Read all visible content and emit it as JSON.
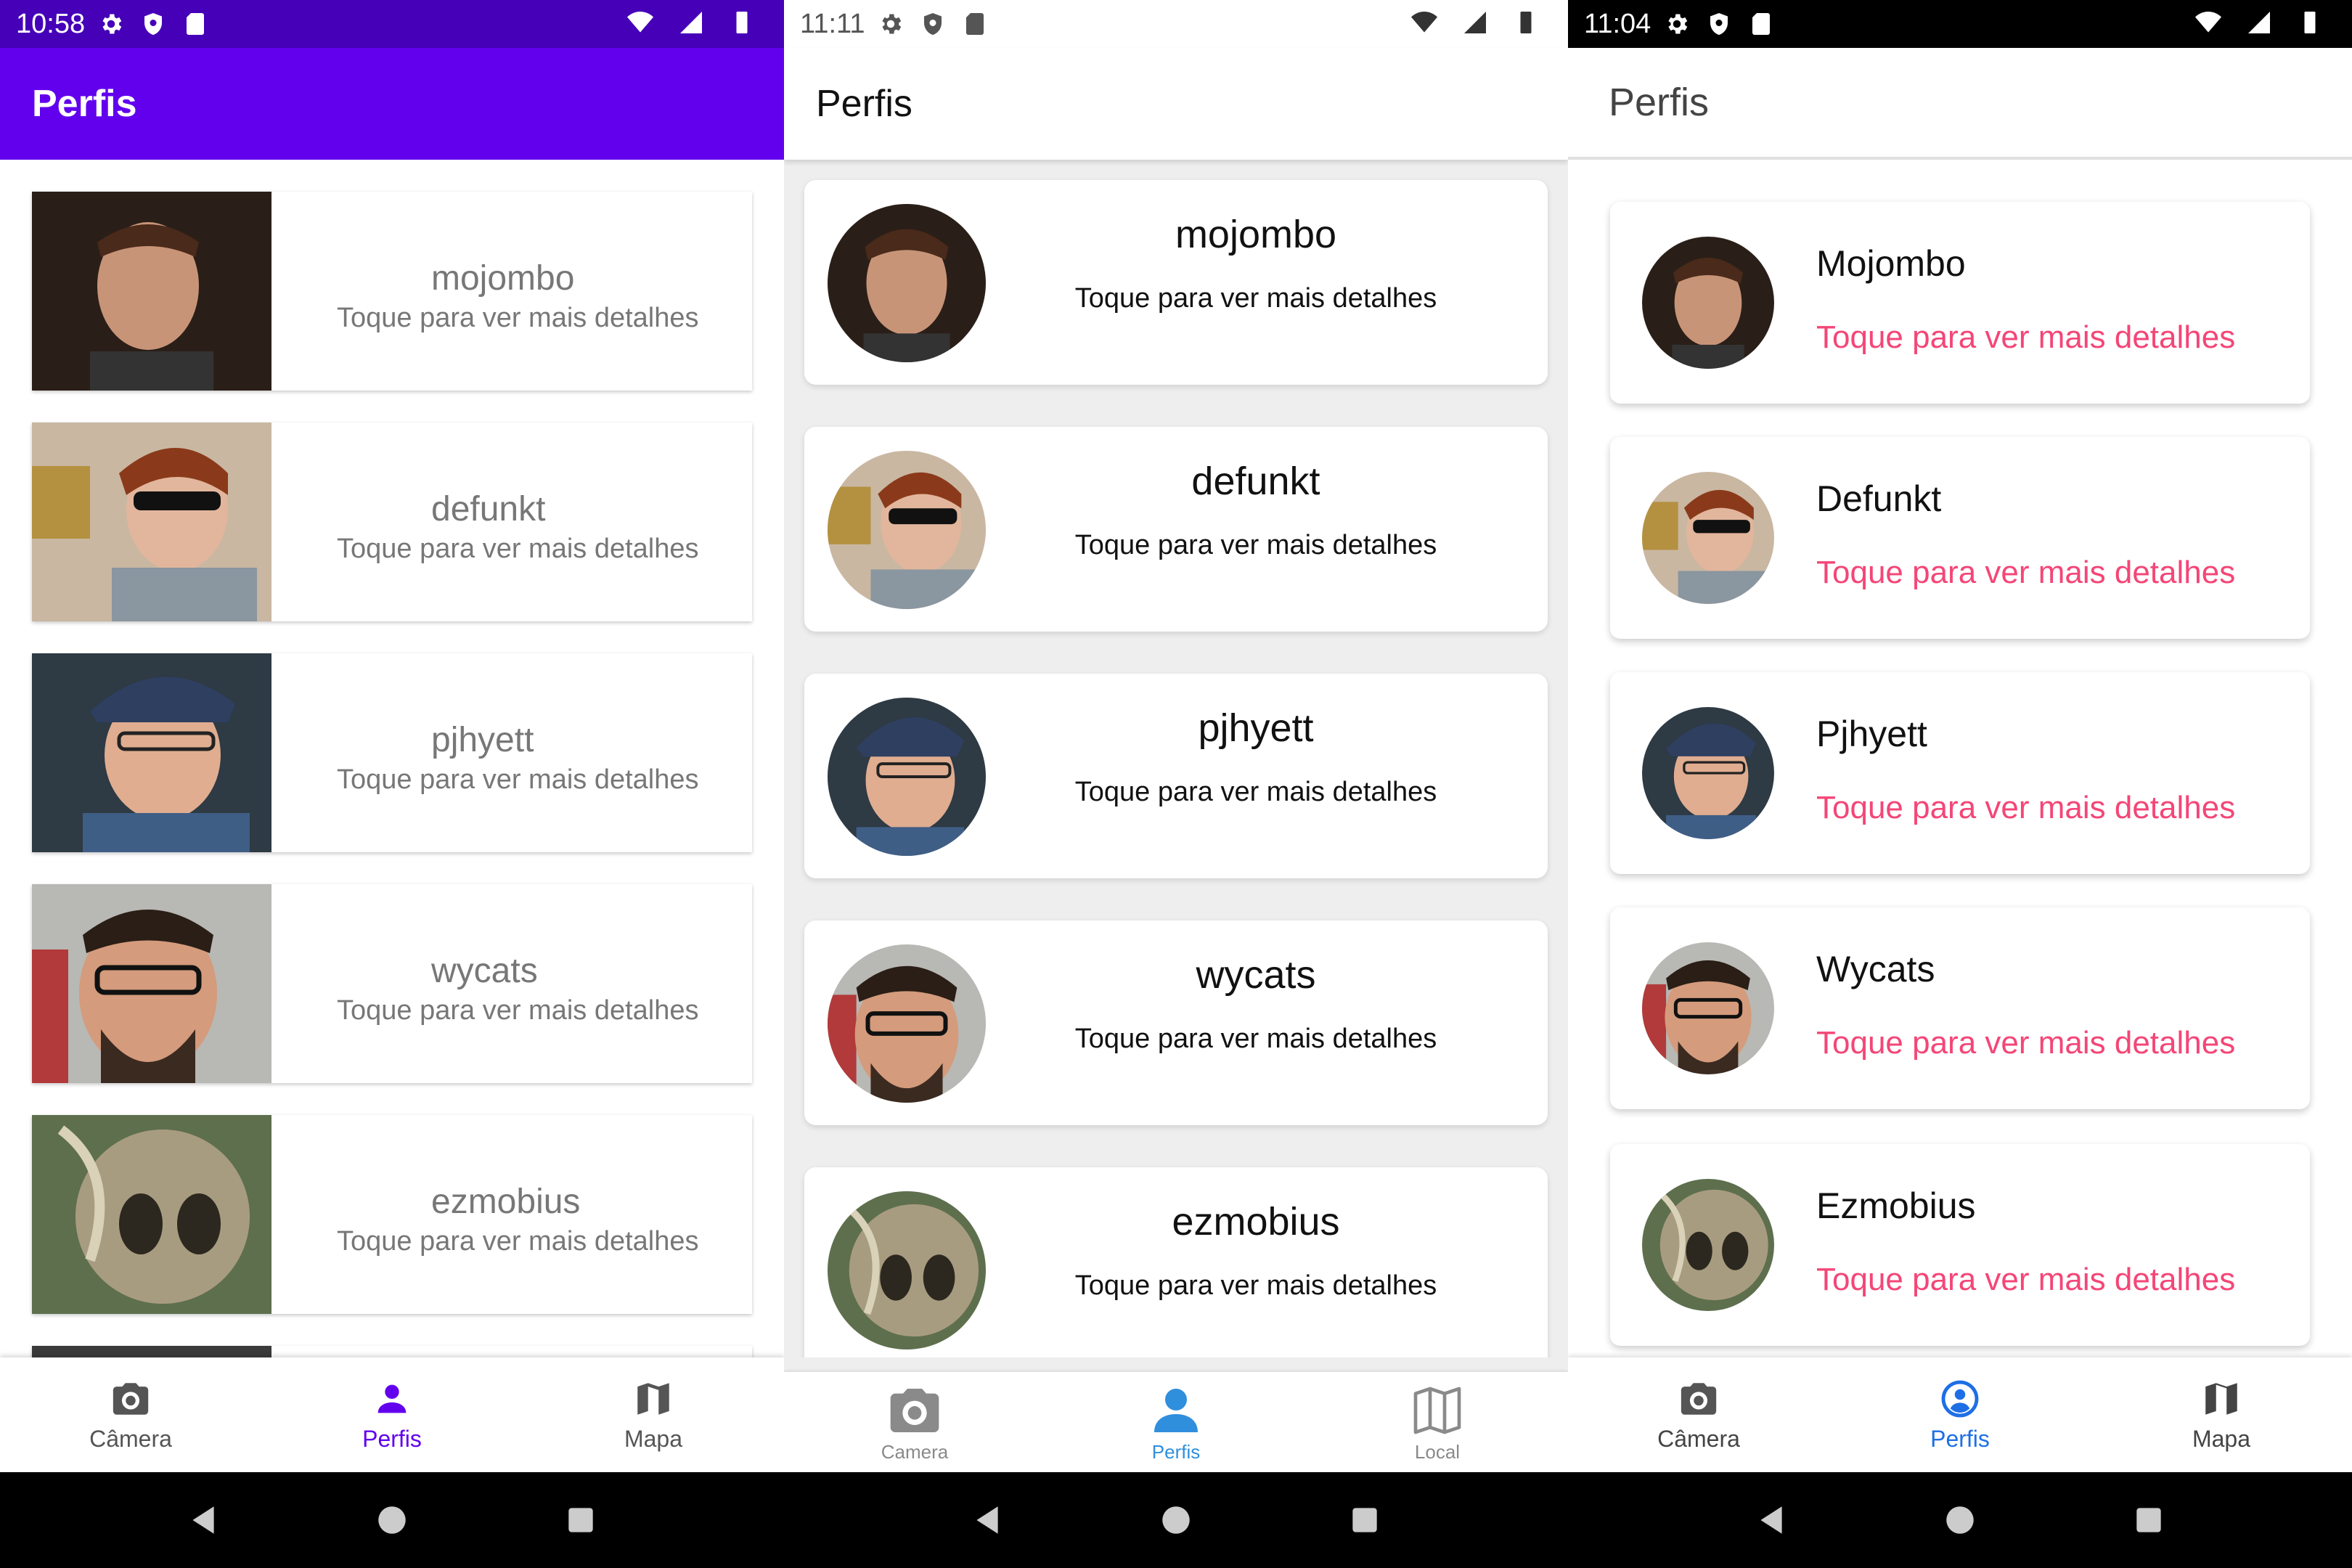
{
  "screens": [
    {
      "time": "10:58",
      "title": "Perfis",
      "profiles": [
        {
          "name": "mojombo",
          "subtitle": "Toque para ver mais detalhes"
        },
        {
          "name": "defunkt",
          "subtitle": "Toque para ver mais detalhes"
        },
        {
          "name": "pjhyett",
          "subtitle": "Toque para ver mais detalhes"
        },
        {
          "name": "wycats",
          "subtitle": "Toque para ver mais detalhes"
        },
        {
          "name": "ezmobius",
          "subtitle": "Toque para ver mais detalhes"
        }
      ],
      "nav": [
        {
          "label": "Câmera",
          "icon": "camera-icon"
        },
        {
          "label": "Perfis",
          "icon": "person-icon",
          "active": true
        },
        {
          "label": "Mapa",
          "icon": "map-icon"
        }
      ],
      "accent": "#6200ee"
    },
    {
      "time": "11:11",
      "title": "Perfis",
      "profiles": [
        {
          "name": "mojombo",
          "subtitle": "Toque para ver mais detalhes"
        },
        {
          "name": "defunkt",
          "subtitle": "Toque para ver mais detalhes"
        },
        {
          "name": "pjhyett",
          "subtitle": "Toque para ver mais detalhes"
        },
        {
          "name": "wycats",
          "subtitle": "Toque para ver mais detalhes"
        },
        {
          "name": "ezmobius",
          "subtitle": "Toque para ver mais detalhes"
        }
      ],
      "nav": [
        {
          "label": "Camera",
          "icon": "camera-icon"
        },
        {
          "label": "Perfis",
          "icon": "person-icon",
          "active": true
        },
        {
          "label": "Local",
          "icon": "map-icon"
        }
      ],
      "accent": "#2f8fdd"
    },
    {
      "time": "11:04",
      "title": "Perfis",
      "profiles": [
        {
          "name": "Mojombo",
          "subtitle": "Toque para ver mais detalhes"
        },
        {
          "name": "Defunkt",
          "subtitle": "Toque para ver mais detalhes"
        },
        {
          "name": "Pjhyett",
          "subtitle": "Toque para ver mais detalhes"
        },
        {
          "name": "Wycats",
          "subtitle": "Toque para ver mais detalhes"
        },
        {
          "name": "Ezmobius",
          "subtitle": "Toque para ver mais detalhes"
        }
      ],
      "nav": [
        {
          "label": "Câmera",
          "icon": "camera-icon"
        },
        {
          "label": "Perfis",
          "icon": "account-circle-icon",
          "active": true
        },
        {
          "label": "Mapa",
          "icon": "map-icon"
        }
      ],
      "accent": "#1e6fe6",
      "subtitle_color": "#f44677"
    }
  ]
}
